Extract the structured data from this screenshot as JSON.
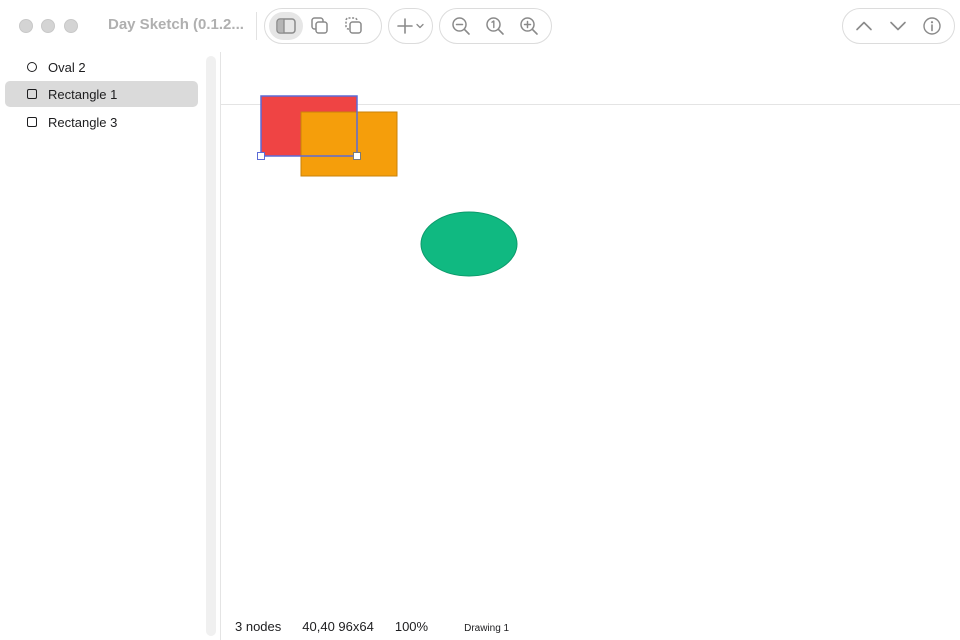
{
  "window": {
    "title": "Day Sketch (0.1.2..."
  },
  "toolbar": {
    "groups": [
      {
        "buttons": [
          {
            "icon": "sidebar-toggle-icon",
            "active": true
          },
          {
            "icon": "duplicate-icon",
            "active": false
          },
          {
            "icon": "copy-icon",
            "active": false
          }
        ]
      },
      {
        "buttons": [
          {
            "icon": "add-icon",
            "menu": true
          }
        ]
      },
      {
        "buttons": [
          {
            "icon": "zoom-out-icon"
          },
          {
            "icon": "zoom-actual-icon"
          },
          {
            "icon": "zoom-in-icon"
          }
        ]
      },
      {
        "buttons": [
          {
            "icon": "chevron-up-icon"
          },
          {
            "icon": "chevron-down-icon"
          },
          {
            "icon": "info-icon"
          }
        ]
      }
    ]
  },
  "sidebar": {
    "items": [
      {
        "label": "Oval 2",
        "icon": "oval-icon",
        "selected": false
      },
      {
        "label": "Rectangle 1",
        "icon": "rectangle-icon",
        "selected": true
      },
      {
        "label": "Rectangle 3",
        "icon": "rectangle-icon",
        "selected": false
      }
    ]
  },
  "canvas": {
    "colors": {
      "rectangle_1": "#ef4444",
      "rectangle_3": "#f59e0b",
      "oval_2": "#10b981",
      "selection": "#5b6bd6"
    }
  },
  "status": {
    "node_count": "3 nodes",
    "selection_geometry": "40,40 96x64",
    "zoom": "100%",
    "document": "Drawing 1"
  }
}
